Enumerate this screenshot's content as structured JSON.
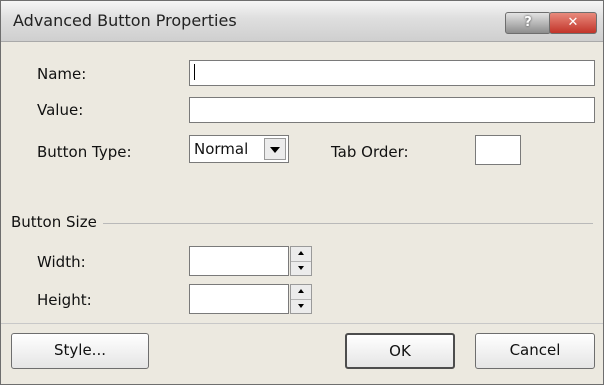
{
  "dialog": {
    "title": "Advanced Button Properties",
    "help_label": "?",
    "close_label": "✕"
  },
  "fields": {
    "name_label": "Name:",
    "name_value": "",
    "value_label": "Value:",
    "value_value": "",
    "button_type_label": "Button Type:",
    "button_type_selected": "Normal",
    "tab_order_label": "Tab Order:",
    "tab_order_value": ""
  },
  "button_size": {
    "group_label": "Button Size",
    "width_label": "Width:",
    "width_value": "",
    "height_label": "Height:",
    "height_value": ""
  },
  "footer": {
    "style_label": "Style...",
    "ok_label": "OK",
    "cancel_label": "Cancel"
  }
}
